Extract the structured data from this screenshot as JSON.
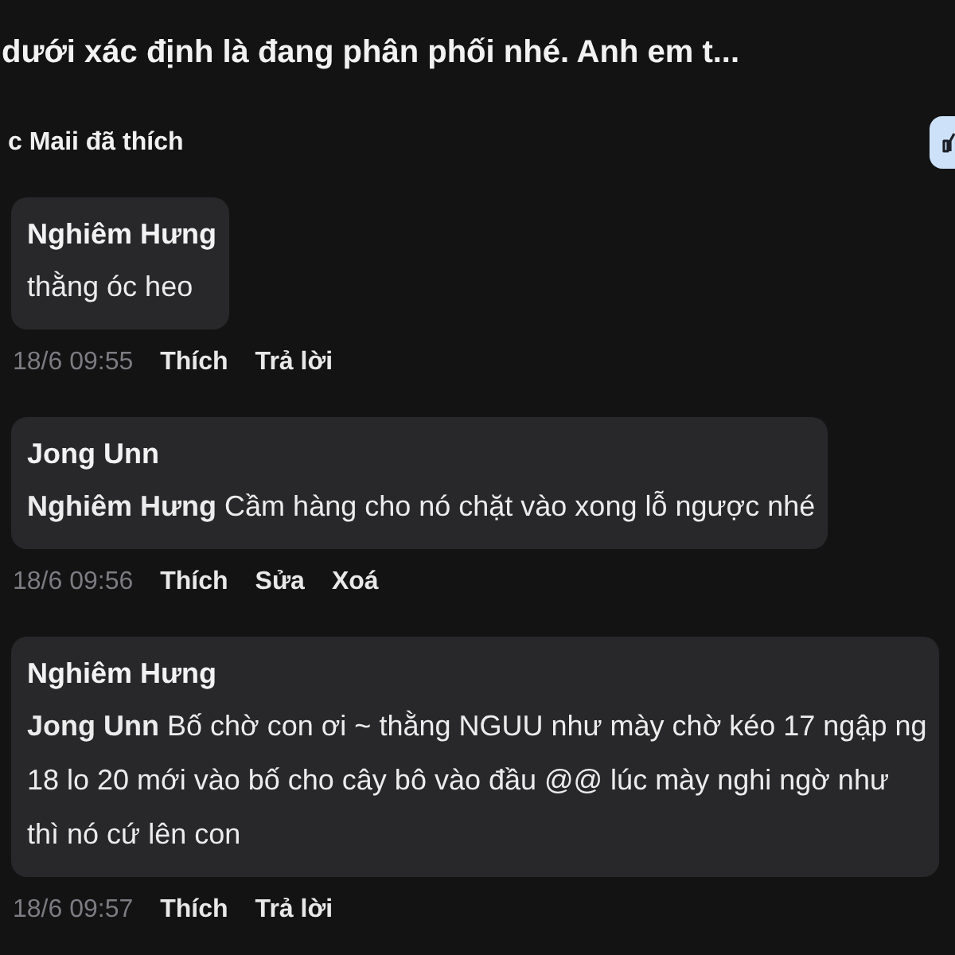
{
  "post": {
    "title": "dưới xác định là đang phân phối nhé. Anh em t...",
    "likes_text": "c Maii đã thích",
    "liked": true
  },
  "comments": [
    {
      "author": "Nghiêm Hưng",
      "lines": [
        "thằng óc heo"
      ],
      "time": "18/6 09:55",
      "actions": [
        "Thích",
        "Trả lời"
      ]
    },
    {
      "author": "Jong Unn",
      "mention": "Nghiêm Hưng",
      "lines": [
        "Cầm hàng cho nó chặt vào xong lỗ ngược nhé"
      ],
      "time": "18/6 09:56",
      "actions": [
        "Thích",
        "Sửa",
        "Xoá"
      ]
    },
    {
      "author": "Nghiêm Hưng",
      "mention": "Jong Unn",
      "lines": [
        "Bố chờ con ơi ~ thằng NGUU như mày chờ kéo 17 ngập ng",
        "18 lo 20 mới vào bố cho cây bô vào đầu @@ lúc mày nghi ngờ như",
        "thì nó cứ lên con"
      ],
      "time": "18/6 09:57",
      "actions": [
        "Thích",
        "Trả lời"
      ]
    }
  ]
}
